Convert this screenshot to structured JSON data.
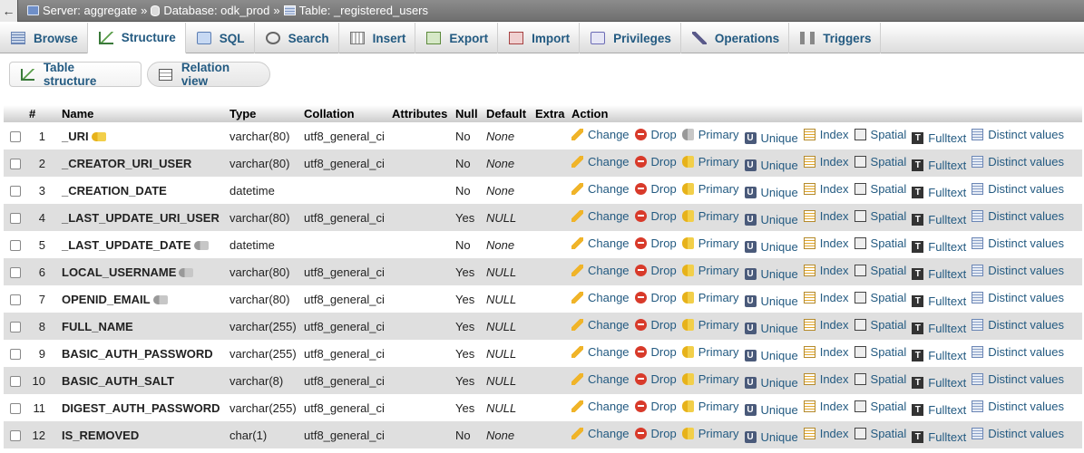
{
  "breadcrumb": {
    "back_glyph": "←",
    "separator": "»",
    "server": "Server: aggregate",
    "database": "Database: odk_prod",
    "table": "Table: _registered_users"
  },
  "tabs": [
    {
      "label": "Browse",
      "icon": "browse-icon"
    },
    {
      "label": "Structure",
      "icon": "structure-icon",
      "active": true
    },
    {
      "label": "SQL",
      "icon": "sql-icon"
    },
    {
      "label": "Search",
      "icon": "search-icon"
    },
    {
      "label": "Insert",
      "icon": "insert-icon"
    },
    {
      "label": "Export",
      "icon": "export-icon"
    },
    {
      "label": "Import",
      "icon": "import-icon"
    },
    {
      "label": "Privileges",
      "icon": "privileges-icon"
    },
    {
      "label": "Operations",
      "icon": "operations-icon"
    },
    {
      "label": "Triggers",
      "icon": "triggers-icon"
    }
  ],
  "subtabs": {
    "structure": "Table structure",
    "relation": "Relation view"
  },
  "columns": [
    "#",
    "Name",
    "Type",
    "Collation",
    "Attributes",
    "Null",
    "Default",
    "Extra",
    "Action"
  ],
  "actions": {
    "change": "Change",
    "drop": "Drop",
    "primary": "Primary",
    "unique": "Unique",
    "index": "Index",
    "spatial": "Spatial",
    "fulltext": "Fulltext",
    "distinct": "Distinct values",
    "unique_glyph": "U",
    "fulltext_glyph": "T"
  },
  "rows": [
    {
      "num": "1",
      "name": "_URI",
      "type": "varchar(80)",
      "collation": "utf8_general_ci",
      "attributes": "",
      "null": "No",
      "default": "None",
      "extra": "",
      "key": "primary"
    },
    {
      "num": "2",
      "name": "_CREATOR_URI_USER",
      "type": "varchar(80)",
      "collation": "utf8_general_ci",
      "attributes": "",
      "null": "No",
      "default": "None",
      "extra": "",
      "key": ""
    },
    {
      "num": "3",
      "name": "_CREATION_DATE",
      "type": "datetime",
      "collation": "",
      "attributes": "",
      "null": "No",
      "default": "None",
      "extra": "",
      "key": ""
    },
    {
      "num": "4",
      "name": "_LAST_UPDATE_URI_USER",
      "type": "varchar(80)",
      "collation": "utf8_general_ci",
      "attributes": "",
      "null": "Yes",
      "default": "NULL",
      "extra": "",
      "key": ""
    },
    {
      "num": "5",
      "name": "_LAST_UPDATE_DATE",
      "type": "datetime",
      "collation": "",
      "attributes": "",
      "null": "No",
      "default": "None",
      "extra": "",
      "key": "index"
    },
    {
      "num": "6",
      "name": "LOCAL_USERNAME",
      "type": "varchar(80)",
      "collation": "utf8_general_ci",
      "attributes": "",
      "null": "Yes",
      "default": "NULL",
      "extra": "",
      "key": "index"
    },
    {
      "num": "7",
      "name": "OPENID_EMAIL",
      "type": "varchar(80)",
      "collation": "utf8_general_ci",
      "attributes": "",
      "null": "Yes",
      "default": "NULL",
      "extra": "",
      "key": "index"
    },
    {
      "num": "8",
      "name": "FULL_NAME",
      "type": "varchar(255)",
      "collation": "utf8_general_ci",
      "attributes": "",
      "null": "Yes",
      "default": "NULL",
      "extra": "",
      "key": ""
    },
    {
      "num": "9",
      "name": "BASIC_AUTH_PASSWORD",
      "type": "varchar(255)",
      "collation": "utf8_general_ci",
      "attributes": "",
      "null": "Yes",
      "default": "NULL",
      "extra": "",
      "key": ""
    },
    {
      "num": "10",
      "name": "BASIC_AUTH_SALT",
      "type": "varchar(8)",
      "collation": "utf8_general_ci",
      "attributes": "",
      "null": "Yes",
      "default": "NULL",
      "extra": "",
      "key": ""
    },
    {
      "num": "11",
      "name": "DIGEST_AUTH_PASSWORD",
      "type": "varchar(255)",
      "collation": "utf8_general_ci",
      "attributes": "",
      "null": "Yes",
      "default": "NULL",
      "extra": "",
      "key": ""
    },
    {
      "num": "12",
      "name": "IS_REMOVED",
      "type": "char(1)",
      "collation": "utf8_general_ci",
      "attributes": "",
      "null": "No",
      "default": "None",
      "extra": "",
      "key": ""
    }
  ]
}
